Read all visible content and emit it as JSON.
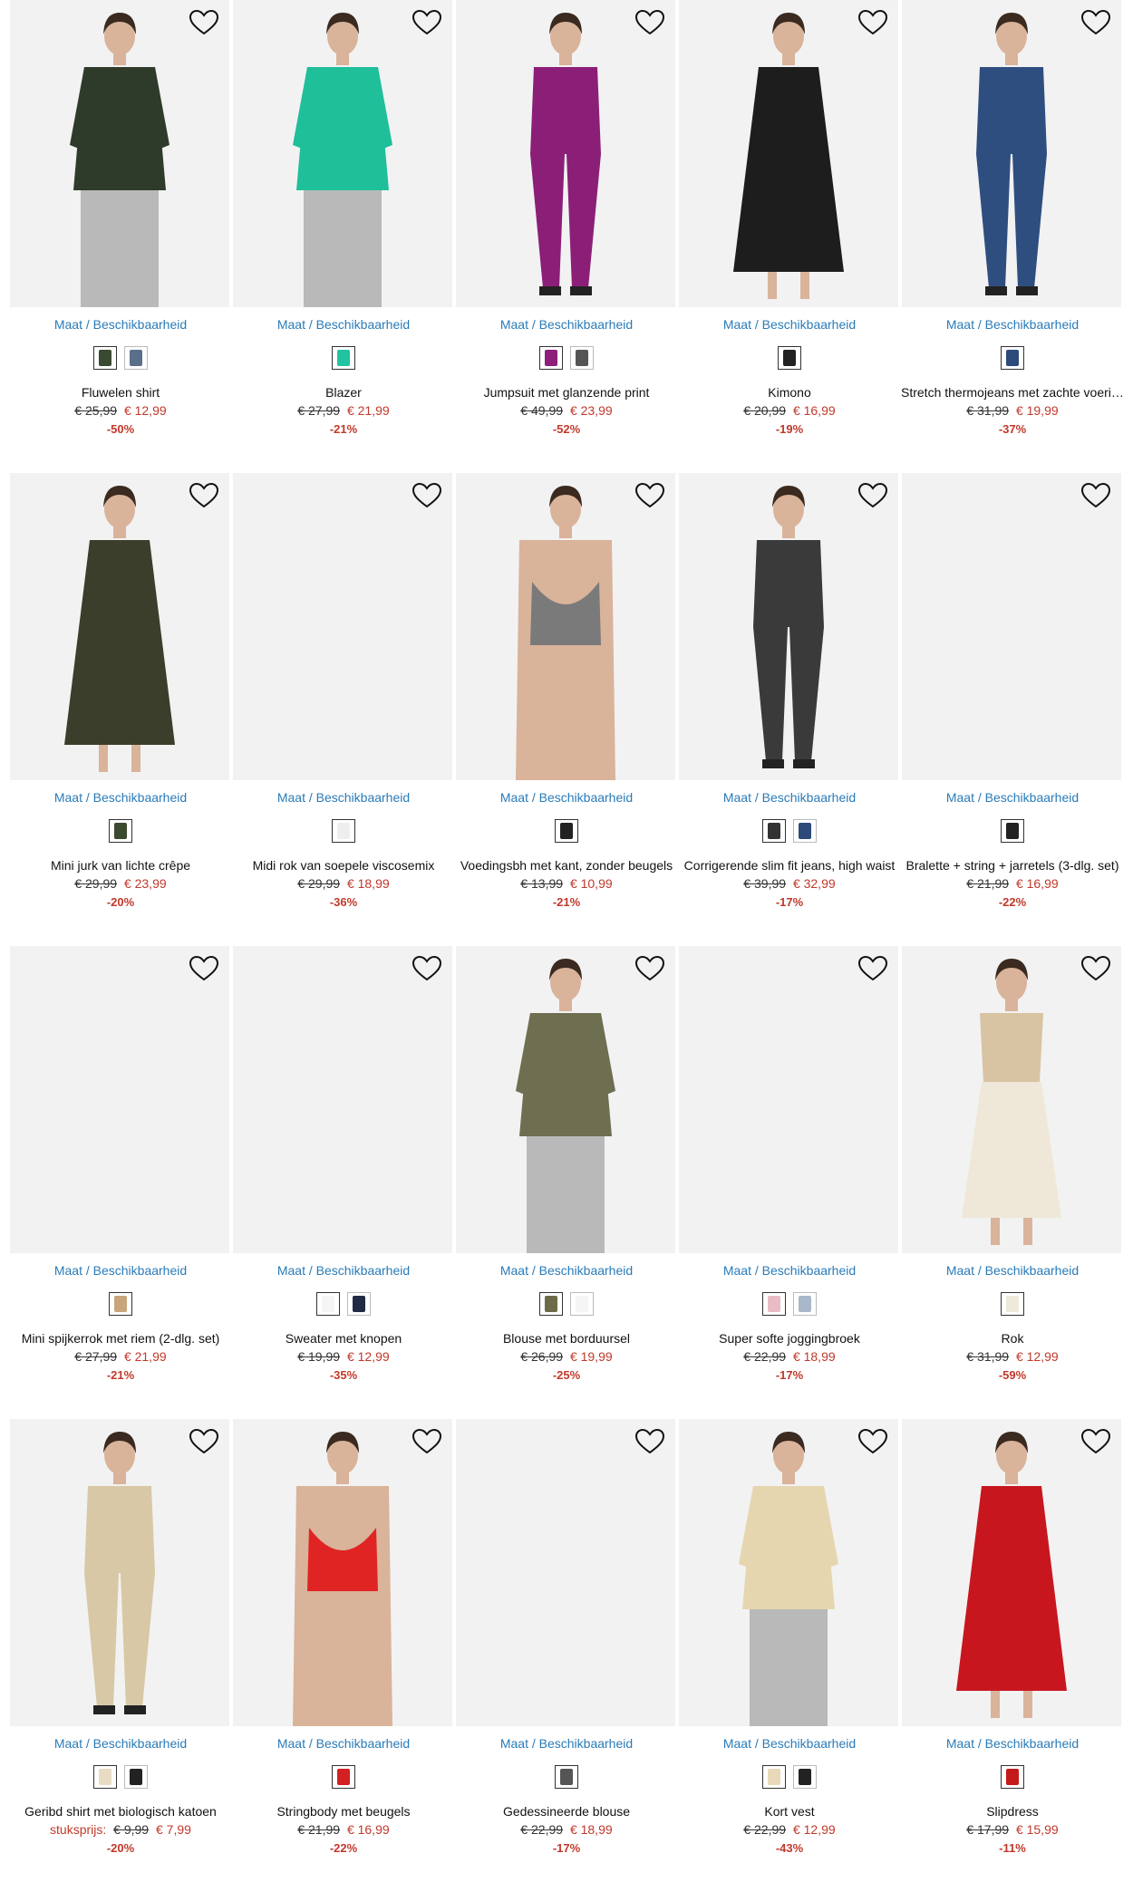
{
  "colors": {
    "link": "#2a7bb8",
    "sale": "#c0392b",
    "card_bg": "#f2f2f2"
  },
  "availability_label_maat": "Maat",
  "availability_label_sep": "/",
  "availability_label_stock": "Beschikbaarheid",
  "products": [
    {
      "name": "Fluwelen shirt",
      "old_price": "€ 25,99",
      "new_price": "€ 12,99",
      "discount": "-50%",
      "swatches": [
        "#3a4a32",
        "#5a6f8a"
      ],
      "fig": "#2f3b2a",
      "fig_kind": "top"
    },
    {
      "name": "Blazer",
      "old_price": "€ 27,99",
      "new_price": "€ 21,99",
      "discount": "-21%",
      "swatches": [
        "#22c3a0"
      ],
      "fig": "#1fbf9a",
      "fig_kind": "top"
    },
    {
      "name": "Jumpsuit met glanzende print",
      "old_price": "€ 49,99",
      "new_price": "€ 23,99",
      "discount": "-52%",
      "swatches": [
        "#8d1f7a",
        "#555555"
      ],
      "fig": "#8b1f78",
      "fig_kind": "full"
    },
    {
      "name": "Kimono",
      "old_price": "€ 20,99",
      "new_price": "€ 16,99",
      "discount": "-19%",
      "swatches": [
        "#222222"
      ],
      "fig": "#1d1d1d",
      "fig_kind": "dress"
    },
    {
      "name": "Stretch thermojeans met zachte voering, Bootcut",
      "old_price": "€ 31,99",
      "new_price": "€ 19,99",
      "discount": "-37%",
      "swatches": [
        "#2e4a7a"
      ],
      "fig": "#2f4e80",
      "fig_kind": "full"
    },
    {
      "name": "Mini jurk van lichte crêpe",
      "old_price": "€ 29,99",
      "new_price": "€ 23,99",
      "discount": "-20%",
      "swatches": [
        "#3c4a2e"
      ],
      "fig": "#3a3e2a",
      "fig_kind": "dress"
    },
    {
      "name": "Midi rok van soepele viscosemix",
      "old_price": "€ 29,99",
      "new_price": "€ 18,99",
      "discount": "-36%",
      "swatches": [
        "#eeeeee"
      ],
      "fig": "",
      "fig_kind": "none"
    },
    {
      "name": "Voedingsbh met kant, zonder beugels",
      "old_price": "€ 13,99",
      "new_price": "€ 10,99",
      "discount": "-21%",
      "swatches": [
        "#222222"
      ],
      "fig": "#7a7a7a",
      "fig_kind": "bra"
    },
    {
      "name": "Corrigerende slim fit jeans, high waist",
      "old_price": "€ 39,99",
      "new_price": "€ 32,99",
      "discount": "-17%",
      "swatches": [
        "#333333",
        "#2e4a7a"
      ],
      "fig": "#3a3a3a",
      "fig_kind": "full"
    },
    {
      "name": "Bralette + string + jarretels (3-dlg. set)",
      "old_price": "€ 21,99",
      "new_price": "€ 16,99",
      "discount": "-22%",
      "swatches": [
        "#222222"
      ],
      "fig": "",
      "fig_kind": "none"
    },
    {
      "name": "Mini spijkerrok met riem (2-dlg. set)",
      "old_price": "€ 27,99",
      "new_price": "€ 21,99",
      "discount": "-21%",
      "swatches": [
        "#c8a57a"
      ],
      "fig": "",
      "fig_kind": "none"
    },
    {
      "name": "Sweater met knopen",
      "old_price": "€ 19,99",
      "new_price": "€ 12,99",
      "discount": "-35%",
      "swatches": [
        "#f5f5f5",
        "#1f2a44"
      ],
      "fig": "",
      "fig_kind": "none"
    },
    {
      "name": "Blouse met borduursel",
      "old_price": "€ 26,99",
      "new_price": "€ 19,99",
      "discount": "-25%",
      "swatches": [
        "#6b6b4a",
        "#f5f5f5"
      ],
      "fig": "#6e6e50",
      "fig_kind": "top"
    },
    {
      "name": "Super softe joggingbroek",
      "old_price": "€ 22,99",
      "new_price": "€ 18,99",
      "discount": "-17%",
      "swatches": [
        "#e8bcc4",
        "#a8b8c8"
      ],
      "fig": "",
      "fig_kind": "none"
    },
    {
      "name": "Rok",
      "old_price": "€ 31,99",
      "new_price": "€ 12,99",
      "discount": "-59%",
      "swatches": [
        "#efe9dc"
      ],
      "fig": "#efe8d8",
      "fig_kind": "skirt"
    },
    {
      "name": "Geribd shirt met biologisch katoen",
      "unit_label": "stuksprijs:",
      "old_price": "€ 9,99",
      "new_price": "€ 7,99",
      "discount": "-20%",
      "swatches": [
        "#e9dcc4",
        "#222222"
      ],
      "fig": "#d8c8a6",
      "fig_kind": "full"
    },
    {
      "name": "Stringbody met beugels",
      "old_price": "€ 21,99",
      "new_price": "€ 16,99",
      "discount": "-22%",
      "swatches": [
        "#d42020"
      ],
      "fig": "#e02424",
      "fig_kind": "bra"
    },
    {
      "name": "Gedessineerde blouse",
      "old_price": "€ 22,99",
      "new_price": "€ 18,99",
      "discount": "-17%",
      "swatches": [
        "#555555"
      ],
      "fig": "",
      "fig_kind": "none"
    },
    {
      "name": "Kort vest",
      "old_price": "€ 22,99",
      "new_price": "€ 12,99",
      "discount": "-43%",
      "swatches": [
        "#e8d9b8",
        "#222222"
      ],
      "fig": "#e6d6b0",
      "fig_kind": "top"
    },
    {
      "name": "Slipdress",
      "old_price": "€ 17,99",
      "new_price": "€ 15,99",
      "discount": "-11%",
      "swatches": [
        "#c41a1a"
      ],
      "fig": "#c8161e",
      "fig_kind": "dress"
    }
  ]
}
